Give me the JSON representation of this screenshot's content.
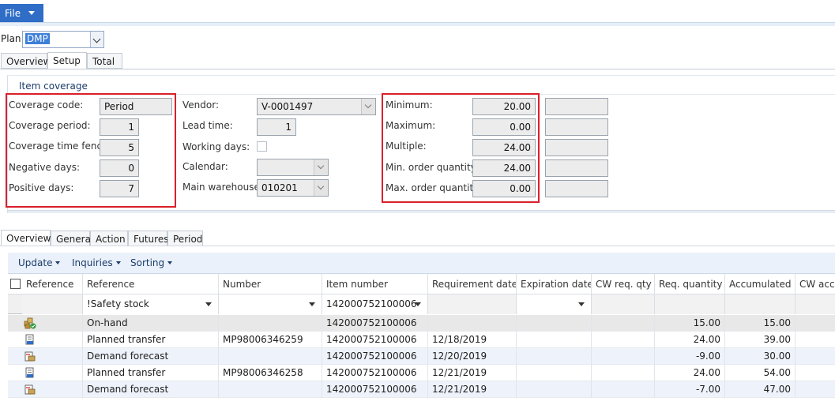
{
  "ribbon": {
    "file_label": "File"
  },
  "plan": {
    "label": "Plan:",
    "value": "DMP"
  },
  "top_tabs": [
    "Overview",
    "Setup",
    "Total"
  ],
  "group_title": "Item coverage",
  "coverage": [
    {
      "label": "Coverage code:",
      "value": "Period"
    },
    {
      "label": "Coverage period:",
      "value": "1"
    },
    {
      "label": "Coverage time fence:",
      "value": "5"
    },
    {
      "label": "Negative days:",
      "value": "0"
    },
    {
      "label": "Positive days:",
      "value": "7"
    }
  ],
  "vendor_fields": [
    {
      "label": "Vendor:",
      "value": "V-0001497"
    },
    {
      "label": "Lead time:",
      "value": "1"
    },
    {
      "label": "Working days:",
      "value": ""
    },
    {
      "label": "Calendar:",
      "value": ""
    },
    {
      "label": "Main warehouse:",
      "value": "010201"
    }
  ],
  "quantities": [
    {
      "label": "Minimum:",
      "value": "20.00"
    },
    {
      "label": "Maximum:",
      "value": "0.00"
    },
    {
      "label": "Multiple:",
      "value": "24.00"
    },
    {
      "label": "Min. order quantity:",
      "value": "24.00"
    },
    {
      "label": "Max. order quantity:",
      "value": "0.00"
    }
  ],
  "lower_tabs": [
    "Overview",
    "General",
    "Action",
    "Futures",
    "Period"
  ],
  "toolbar": {
    "update": "Update",
    "inquiries": "Inquiries",
    "sorting": "Sorting"
  },
  "grid": {
    "headers": [
      "Reference",
      "Reference",
      "Number",
      "Item number",
      "Requirement date",
      "Expiration date",
      "CW req. qty",
      "Req. quantity",
      "Accumulated",
      "CW acc"
    ],
    "filters": {
      "reference": "!Safety stock",
      "item_number": "142000752100006"
    },
    "rows": [
      {
        "icon": "on-hand-icon",
        "reference": "On-hand",
        "number": "",
        "item": "142000752100006",
        "req_date": "",
        "req_qty": "15.00",
        "accum": "15.00"
      },
      {
        "icon": "planned-transfer-icon",
        "reference": "Planned transfer",
        "number": "MP98006346259",
        "item": "142000752100006",
        "req_date": "12/18/2019",
        "req_qty": "24.00",
        "accum": "39.00"
      },
      {
        "icon": "demand-forecast-icon",
        "reference": "Demand forecast",
        "number": "",
        "item": "142000752100006",
        "req_date": "12/20/2019",
        "req_qty": "-9.00",
        "accum": "30.00"
      },
      {
        "icon": "planned-transfer-icon",
        "reference": "Planned transfer",
        "number": "MP98006346258",
        "item": "142000752100006",
        "req_date": "12/21/2019",
        "req_qty": "24.00",
        "accum": "54.00"
      },
      {
        "icon": "demand-forecast-icon",
        "reference": "Demand forecast",
        "number": "",
        "item": "142000752100006",
        "req_date": "12/21/2019",
        "req_qty": "-7.00",
        "accum": "47.00"
      }
    ]
  }
}
